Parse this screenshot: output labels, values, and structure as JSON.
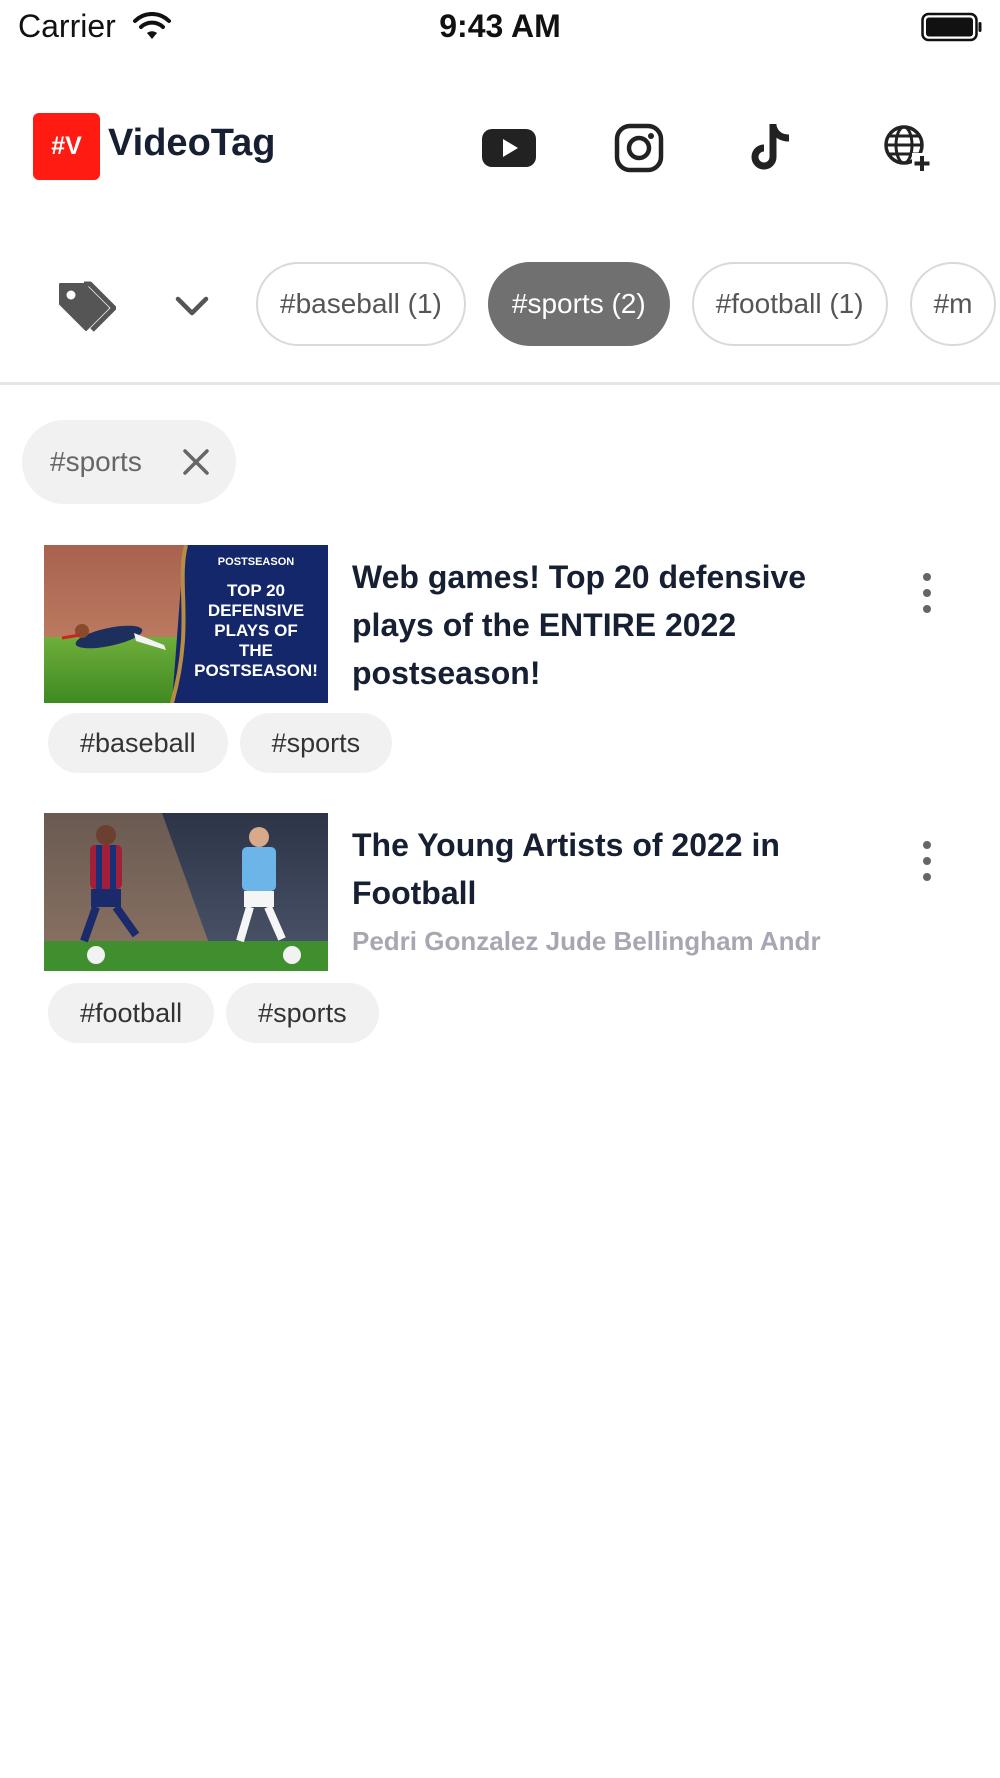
{
  "status_bar": {
    "carrier": "Carrier",
    "time": "9:43 AM"
  },
  "header": {
    "logo_text": "#V",
    "app_name": "VideoTag",
    "icons": [
      "youtube-icon",
      "instagram-icon",
      "tiktok-icon",
      "web-add-icon"
    ]
  },
  "filter_bar": {
    "tags": [
      {
        "label": "#baseball (1)",
        "selected": false
      },
      {
        "label": "#sports (2)",
        "selected": true
      },
      {
        "label": "#football (1)",
        "selected": false
      },
      {
        "label": "#m",
        "selected": false
      }
    ]
  },
  "active_filter": {
    "label": "#sports"
  },
  "videos": [
    {
      "title": "Web games! Top 20 defensive plays of the ENTIRE 2022 postseason!",
      "subtitle": "",
      "thumbnail_text": {
        "badge": "POSTSEASON",
        "lines": [
          "TOP 20",
          "DEFENSIVE",
          "PLAYS OF",
          "THE",
          "POSTSEASON!"
        ]
      },
      "tags": [
        "#baseball",
        "#sports"
      ]
    },
    {
      "title": "The Young Artists of 2022 in Football",
      "subtitle": "Pedri Gonzalez Jude Bellingham Andr",
      "tags": [
        "#football",
        "#sports"
      ]
    }
  ],
  "colors": {
    "brand_red": "#ff1a12",
    "selected_chip": "#707070",
    "title_text": "#172033",
    "subtitle_text": "#a7a7b3"
  }
}
